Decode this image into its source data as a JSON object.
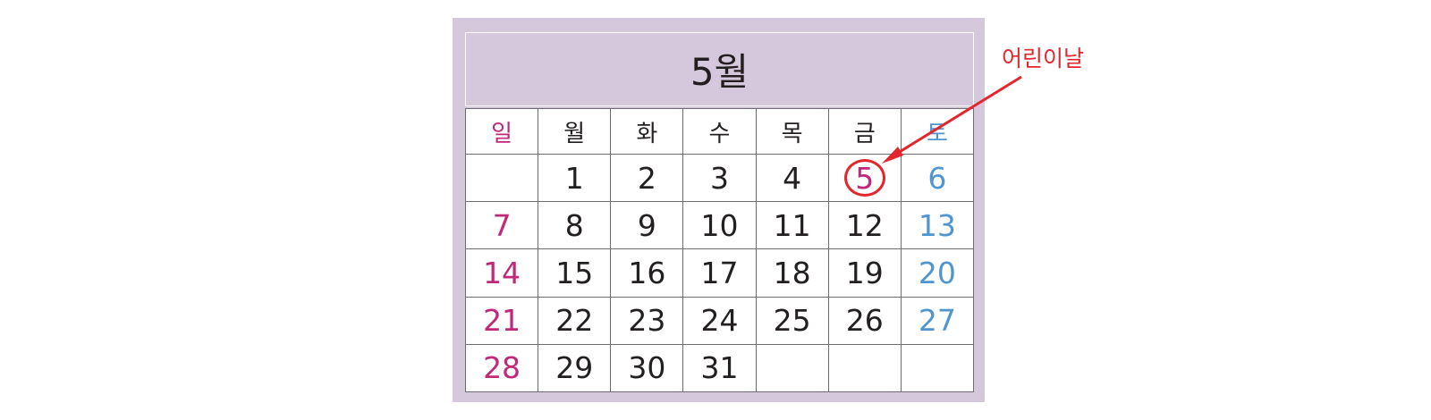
{
  "calendar": {
    "month_title": "5월",
    "weekdays": [
      "일",
      "월",
      "화",
      "수",
      "목",
      "금",
      "토"
    ],
    "weeks": [
      [
        "",
        "1",
        "2",
        "3",
        "4",
        "5",
        "6"
      ],
      [
        "7",
        "8",
        "9",
        "10",
        "11",
        "12",
        "13"
      ],
      [
        "14",
        "15",
        "16",
        "17",
        "18",
        "19",
        "20"
      ],
      [
        "21",
        "22",
        "23",
        "24",
        "25",
        "26",
        "27"
      ],
      [
        "28",
        "29",
        "30",
        "31",
        "",
        "",
        ""
      ]
    ],
    "highlighted_day": "5"
  },
  "annotation": {
    "label": "어린이날"
  },
  "colors": {
    "panel_background": "#d6c8dc",
    "sunday": "#c0287a",
    "saturday": "#4f95cf",
    "highlight": "#e3262b",
    "text": "#231f20",
    "grid_line": "#6d6e71"
  },
  "icons": {
    "highlight_marker": "circle-icon",
    "annotation_pointer": "arrow-icon"
  }
}
